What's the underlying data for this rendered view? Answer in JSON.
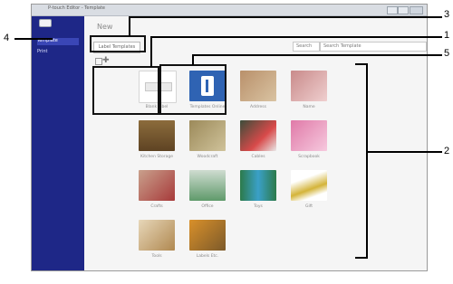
{
  "window": {
    "title": "P-touch Editor - Template"
  },
  "sidebar": {
    "items": [
      "Template",
      "Print"
    ]
  },
  "main": {
    "title": "New",
    "tab_label": "Label Templates",
    "dropdown_label": "Search",
    "search_placeholder": "Search Template",
    "tiles": [
      {
        "caption": "Blank label",
        "image": "blank-label"
      },
      {
        "caption": "Templates Online",
        "image": "online-templates"
      },
      {
        "caption": "Address",
        "image": "address"
      },
      {
        "caption": "Name",
        "image": "name"
      },
      {
        "caption": "Kitchen Storage",
        "image": "kitchen-storage"
      },
      {
        "caption": "Woodcraft",
        "image": "woodcraft"
      },
      {
        "caption": "Cables",
        "image": "cables"
      },
      {
        "caption": "Scrapbook",
        "image": "scrapbook"
      },
      {
        "caption": "Crafts",
        "image": "crafts"
      },
      {
        "caption": "Office",
        "image": "office"
      },
      {
        "caption": "Toys",
        "image": "toys"
      },
      {
        "caption": "Gift",
        "image": "gift"
      },
      {
        "caption": "Tools",
        "image": "tools"
      },
      {
        "caption": "Labels Etc.",
        "image": "labels-etc"
      }
    ]
  },
  "callouts": {
    "c1": "1",
    "c2": "2",
    "c3": "3",
    "c4": "4",
    "c5": "5"
  }
}
